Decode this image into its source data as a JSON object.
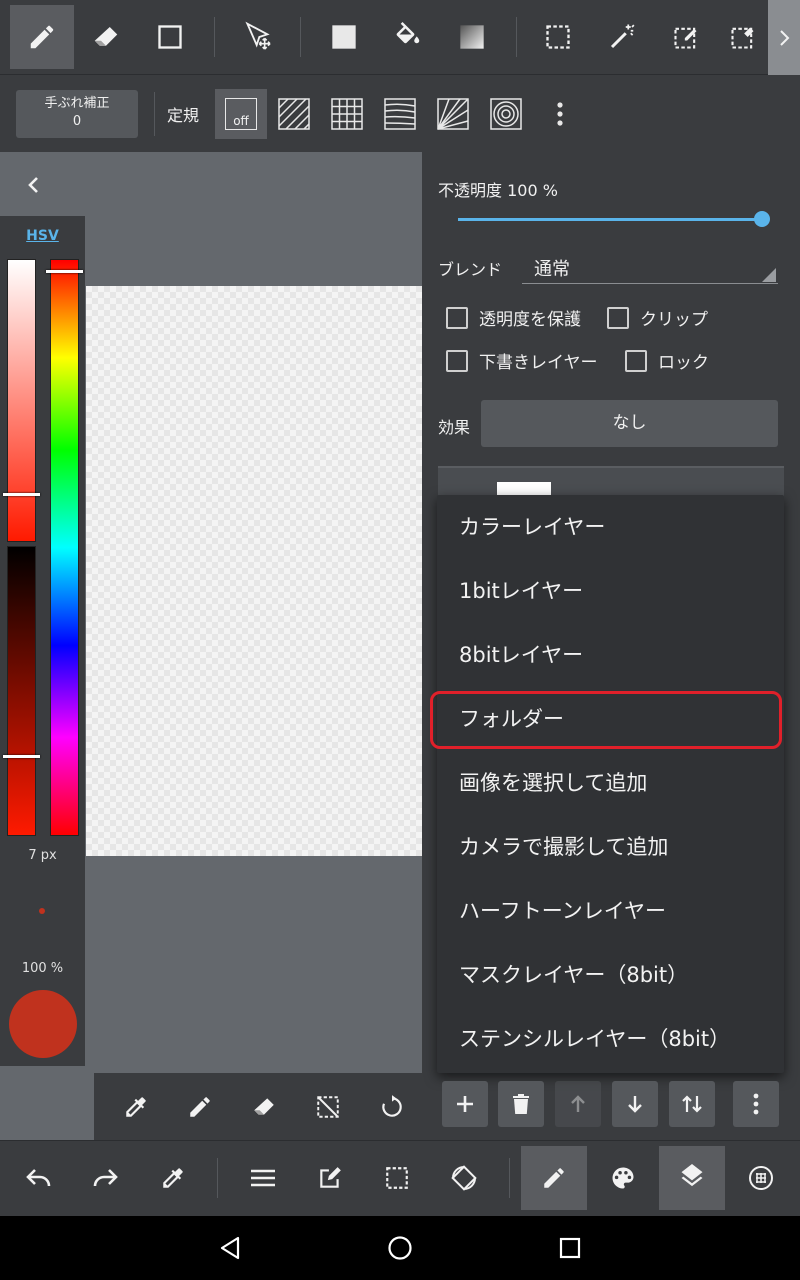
{
  "toolbar_top": {
    "tools": [
      "pen-icon",
      "eraser-icon",
      "rectangle-icon",
      "move-icon",
      "fill-rect-icon",
      "bucket-icon",
      "gradient-icon",
      "select-rect-icon",
      "magic-wand-icon",
      "select-pen-icon",
      "select-eraser-icon"
    ],
    "active_tool": "pen-icon"
  },
  "toolbar_second": {
    "stabilizer_label": "手ぶれ補正",
    "stabilizer_value": "0",
    "ruler_label": "定規",
    "ruler_off_label": "off"
  },
  "color_panel": {
    "mode_label": "HSV",
    "brush_size": "7 px",
    "brush_opacity": "100 %",
    "current_color": "#c0321e"
  },
  "layer_panel": {
    "opacity_label": "不透明度 100 %",
    "opacity_value": 100,
    "blend_label": "ブレンド",
    "blend_value": "通常",
    "checkboxes": {
      "protect_alpha": "透明度を保護",
      "clip": "クリップ",
      "draft_layer": "下書きレイヤー",
      "lock": "ロック"
    },
    "effect_label": "効果",
    "effect_value": "なし"
  },
  "add_layer_menu": {
    "items": [
      "カラーレイヤー",
      "1bitレイヤー",
      "8bitレイヤー",
      "フォルダー",
      "画像を選択して追加",
      "カメラで撮影して追加",
      "ハーフトーンレイヤー",
      "マスクレイヤー（8bit）",
      "ステンシルレイヤー（8bit）"
    ],
    "highlighted_item": "フォルダー",
    "highlight_color": "#e0202a"
  },
  "layer_buttons": [
    "add-icon",
    "trash-icon",
    "arrow-up-icon",
    "arrow-down-icon",
    "swap-icon",
    "more-icon"
  ],
  "quick_tools": [
    "eyedropper-icon",
    "pen-icon",
    "eraser-icon",
    "clear-selection-icon",
    "rotate-icon"
  ],
  "bottom_toolbar": {
    "tools": [
      "undo-icon",
      "redo-icon",
      "eyedropper-icon",
      "menu-icon",
      "edit-icon",
      "selection-icon",
      "rotate-canvas-icon",
      "brush-icon",
      "palette-icon",
      "layers-icon",
      "material-icon"
    ],
    "active_tools": [
      "brush-icon",
      "layers-icon"
    ]
  },
  "colors": {
    "accent": "#5ab4ea",
    "panel_bg": "#3a3c3f",
    "menu_bg": "#303235"
  }
}
